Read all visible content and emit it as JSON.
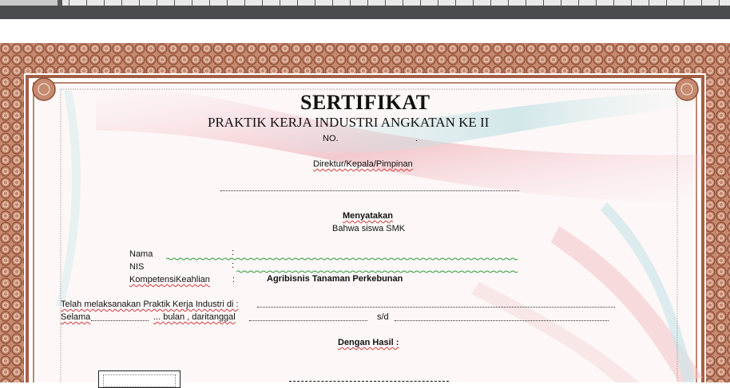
{
  "document": {
    "title": "SERTIFIKAT",
    "subtitle": "PRAKTIK KERJA INDUSTRI ANGKATAN  KE II",
    "number_label": "NO.",
    "number_end": ".",
    "issuer": "Direktur/Kepala/Pimpinan",
    "statement": "Menyatakan",
    "statement_sub": "Bahwa siswa SMK",
    "fields": {
      "nama_label": "Nama",
      "nama_colon": ":",
      "nis_label": "NIS",
      "nis_colon": ":",
      "kompetensi_label": "KompetensiKeahlian",
      "kompetensi_colon": ":",
      "kompetensi_value": "Agribisnis Tanaman  Perkebunan"
    },
    "telah_text": "Telah melaksanakan  Praktik Kerja Industri  di :",
    "selama_text": "Selama",
    "bulan_text": "... bulan  , daritanggal",
    "sd_text": "s/d",
    "hasil": "Dengan Hasil  :"
  },
  "colors": {
    "frame_brown": "#b06b4f",
    "frame_dark": "#8a4a33",
    "spell_red": "#d13a3a",
    "grammar_green": "#2e9e3e"
  }
}
